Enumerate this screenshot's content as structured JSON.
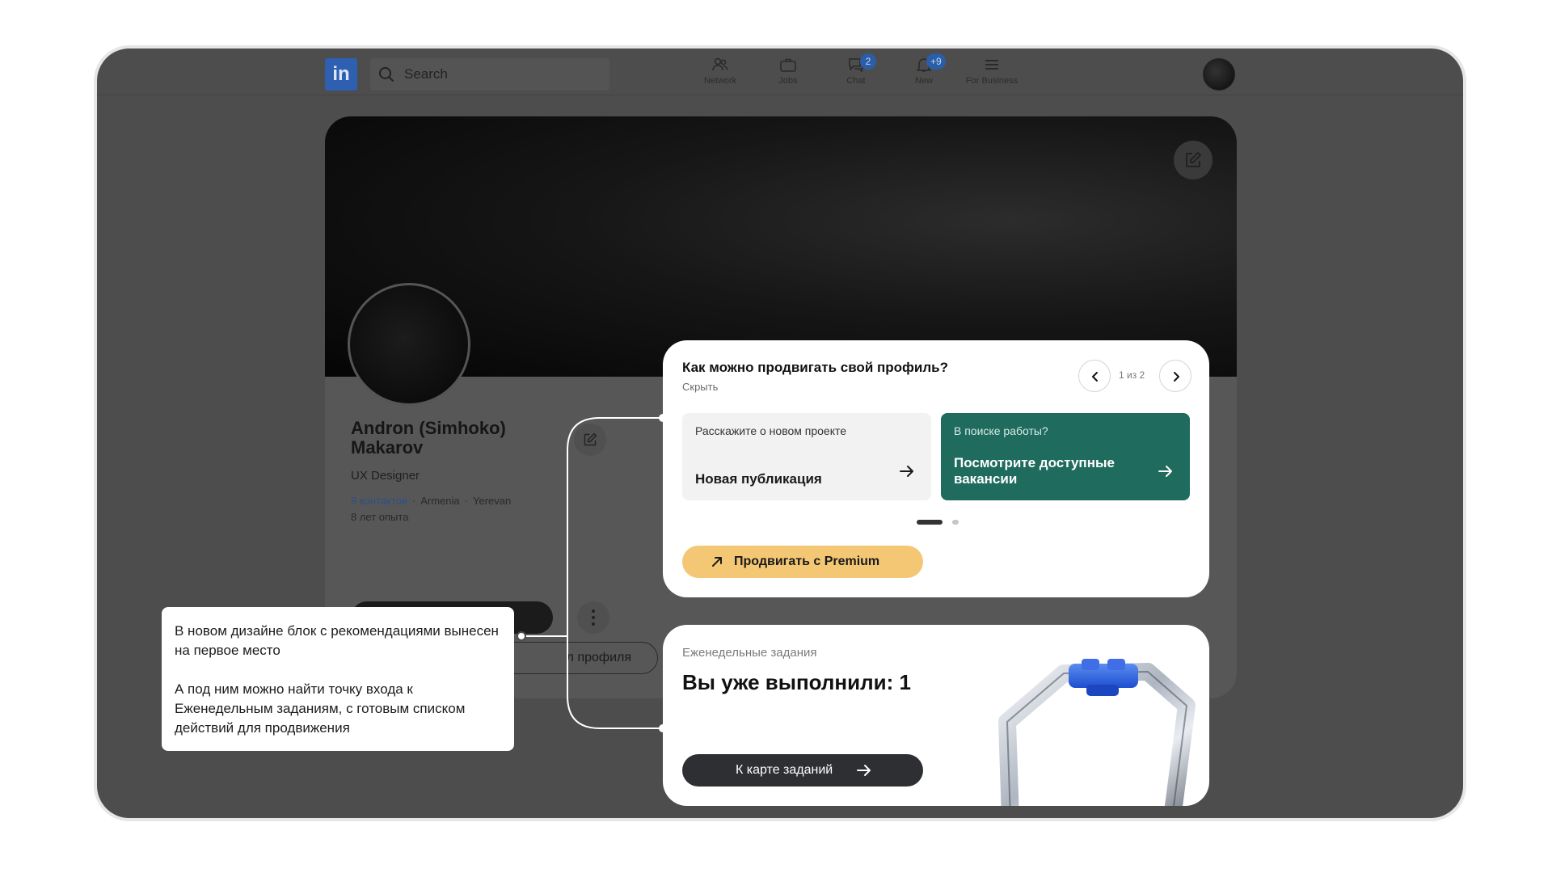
{
  "nav": {
    "logo": "in",
    "search_placeholder": "Search",
    "items": [
      {
        "label": "Network",
        "icon": "network-icon"
      },
      {
        "label": "Jobs",
        "icon": "briefcase-icon"
      },
      {
        "label": "Chat",
        "icon": "chat-icon",
        "badge": "2"
      },
      {
        "label": "New",
        "icon": "bell-icon",
        "badge": "+9"
      },
      {
        "label": "For Business",
        "icon": "menu-icon"
      }
    ]
  },
  "profile": {
    "name": "Andron (Simhoko) Makarov",
    "role": "UX Designer",
    "contacts": "9 контактов",
    "country": "Armenia",
    "city": "Yerevan",
    "experience": "8 лет опыта",
    "outline_button_partial": "л профиля"
  },
  "note": {
    "paragraph1": "В новом дизайне блок с рекомендациями вынесен на первое место",
    "paragraph2": "А под ним можно найти точку входа к Еженедельным заданиям, с готовым списком действий для продвижения"
  },
  "promo": {
    "title": "Как можно продвигать свой профиль?",
    "hide": "Скрыть",
    "pager": "1 из 2",
    "card1_top": "Расскажите о новом проекте",
    "card1_main": "Новая публикация",
    "card2_top": "В поиске работы?",
    "card2_main": "Посмотрите доступные вакансии",
    "premium_button": "Продвигать с Premium",
    "colors": {
      "premium": "#f4c774",
      "jobs_card": "#1f6b5e"
    }
  },
  "weekly": {
    "label": "Еженедельные задания",
    "title": "Вы уже выполнили: 1",
    "button": "К карте заданий"
  }
}
